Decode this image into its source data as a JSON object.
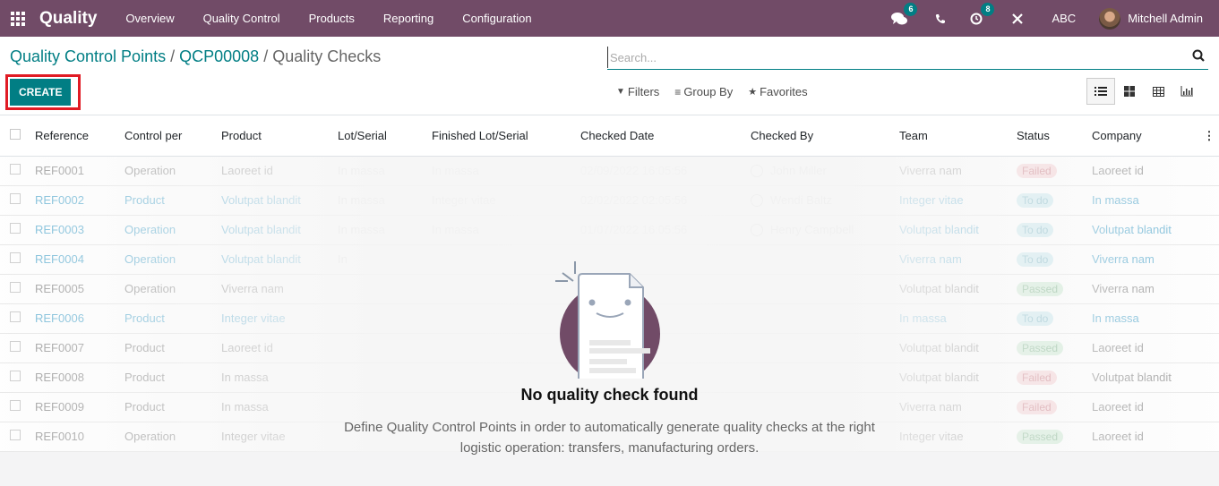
{
  "navbar": {
    "app_name": "Quality",
    "menu": [
      "Overview",
      "Quality Control",
      "Products",
      "Reporting",
      "Configuration"
    ],
    "messages_count": "6",
    "activities_count": "8",
    "company": "ABC",
    "user": "Mitchell Admin",
    "accent": "#714b67"
  },
  "breadcrumb": {
    "items": [
      "Quality Control Points",
      "QCP00008"
    ],
    "current": "Quality Checks"
  },
  "toolbar": {
    "create_label": "CREATE",
    "search_placeholder": "Search...",
    "filters_label": "Filters",
    "groupby_label": "Group By",
    "favorites_label": "Favorites",
    "views": [
      "list-view",
      "kanban-view",
      "pivot-view",
      "graph-view"
    ],
    "active_view": "list-view"
  },
  "table": {
    "columns": [
      "Reference",
      "Control per",
      "Product",
      "Lot/Serial",
      "Finished Lot/Serial",
      "Checked Date",
      "Checked By",
      "Team",
      "Status",
      "Company"
    ],
    "rows": [
      {
        "ref": "REF0001",
        "control": "Operation",
        "product": "Laoreet id",
        "lot": "In massa",
        "finished": "In massa",
        "date": "02/09/2022 16:05:56",
        "by": "John Miller",
        "team": "Viverra nam",
        "status": "Failed",
        "company": "Laoreet id",
        "link": false
      },
      {
        "ref": "REF0002",
        "control": "Product",
        "product": "Volutpat blandit",
        "lot": "In massa",
        "finished": "Integer vitae",
        "date": "02/02/2022 02:05:56",
        "by": "Wendi Baltz",
        "team": "Integer vitae",
        "status": "To do",
        "company": "In massa",
        "link": true
      },
      {
        "ref": "REF0003",
        "control": "Operation",
        "product": "Volutpat blandit",
        "lot": "In massa",
        "finished": "In massa",
        "date": "01/07/2022 16:05:56",
        "by": "Henry Campbell",
        "team": "Volutpat blandit",
        "status": "To do",
        "company": "Volutpat blandit",
        "link": true
      },
      {
        "ref": "REF0004",
        "control": "Operation",
        "product": "Volutpat blandit",
        "lot": "In",
        "finished": "",
        "date": "",
        "by": "",
        "team": "Viverra nam",
        "status": "To do",
        "company": "Viverra nam",
        "link": true
      },
      {
        "ref": "REF0005",
        "control": "Operation",
        "product": "Viverra nam",
        "lot": "",
        "finished": "",
        "date": "",
        "by": "",
        "team": "Volutpat blandit",
        "status": "Passed",
        "company": "Viverra nam",
        "link": false
      },
      {
        "ref": "REF0006",
        "control": "Product",
        "product": "Integer vitae",
        "lot": "",
        "finished": "",
        "date": "",
        "by": "",
        "team": "In massa",
        "status": "To do",
        "company": "In massa",
        "link": true
      },
      {
        "ref": "REF0007",
        "control": "Product",
        "product": "Laoreet id",
        "lot": "",
        "finished": "",
        "date": "",
        "by": "",
        "team": "Volutpat blandit",
        "status": "Passed",
        "company": "Laoreet id",
        "link": false
      },
      {
        "ref": "REF0008",
        "control": "Product",
        "product": "In massa",
        "lot": "",
        "finished": "",
        "date": "",
        "by": "",
        "team": "Volutpat blandit",
        "status": "Failed",
        "company": "Volutpat blandit",
        "link": false
      },
      {
        "ref": "REF0009",
        "control": "Product",
        "product": "In massa",
        "lot": "",
        "finished": "",
        "date": "",
        "by": "",
        "team": "Viverra nam",
        "status": "Failed",
        "company": "Laoreet id",
        "link": false
      },
      {
        "ref": "REF0010",
        "control": "Operation",
        "product": "Integer vitae",
        "lot": "",
        "finished": "",
        "date": "",
        "by": "",
        "team": "Integer vitae",
        "status": "Passed",
        "company": "Laoreet id",
        "link": false
      }
    ]
  },
  "empty_state": {
    "title": "No quality check found",
    "text_line1": "Define Quality Control Points in order to automatically generate quality checks at the right",
    "text_line2": "logistic operation: transfers, manufacturing orders."
  }
}
